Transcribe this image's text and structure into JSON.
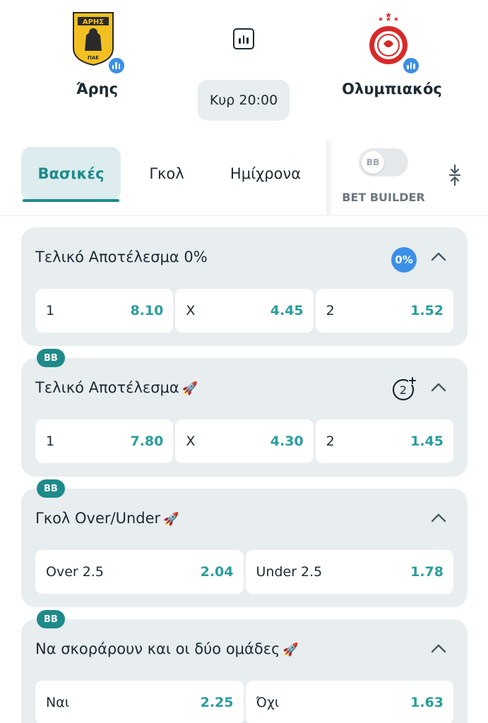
{
  "match": {
    "home": {
      "name": "Άρης",
      "crest_text": "ΑΡΗΣ",
      "crest_sub": "ΠΑΕ",
      "crest_color": "#f2c020"
    },
    "away": {
      "name": "Ολυμπιακός",
      "crest_color": "#d72a2a"
    },
    "kickoff": "Κυρ 20:00"
  },
  "tabs": [
    {
      "label": "Βασικές",
      "active": true
    },
    {
      "label": "Γκολ",
      "active": false
    },
    {
      "label": "Ημίχρονα",
      "active": false
    }
  ],
  "bet_builder": {
    "toggle_text": "BB",
    "label": "BET BUILDER",
    "enabled": false
  },
  "markets": [
    {
      "title": "Τελικό Αποτέλεσμα 0%",
      "badge": "0%",
      "bb": false,
      "odds": [
        {
          "label": "1",
          "value": "8.10"
        },
        {
          "label": "X",
          "value": "4.45"
        },
        {
          "label": "2",
          "value": "1.52"
        }
      ]
    },
    {
      "title": "Τελικό Αποτέλεσμα",
      "bb": true,
      "bb_text": "BB",
      "odds": [
        {
          "label": "1",
          "value": "7.80"
        },
        {
          "label": "X",
          "value": "4.30"
        },
        {
          "label": "2",
          "value": "1.45"
        }
      ]
    },
    {
      "title": "Γκολ Over/Under",
      "bb": true,
      "bb_text": "BB",
      "odds": [
        {
          "label": "Over 2.5",
          "value": "2.04"
        },
        {
          "label": "Under 2.5",
          "value": "1.78"
        }
      ]
    },
    {
      "title": "Να σκοράρουν και οι δύο ομάδες",
      "bb": true,
      "bb_text": "BB",
      "odds": [
        {
          "label": "Ναι",
          "value": "2.25"
        },
        {
          "label": "Όχι",
          "value": "1.63"
        }
      ]
    }
  ],
  "colors": {
    "accent": "#1e8a8a",
    "odds": "#2a9d9d",
    "card_bg": "#e8edf0",
    "badge_blue": "#3b8fe6"
  }
}
